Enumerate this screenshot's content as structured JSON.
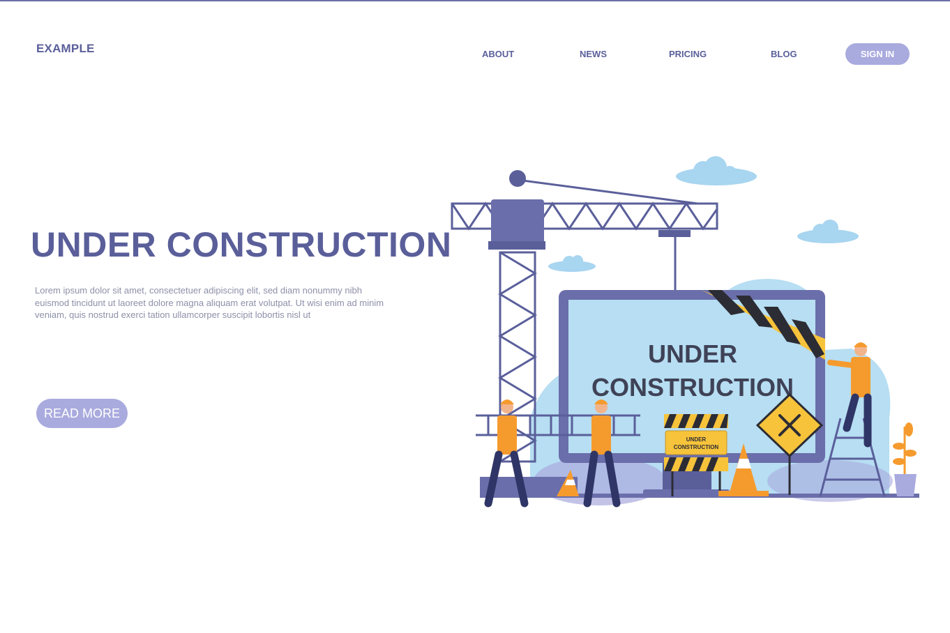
{
  "header": {
    "logo": "EXAMPLE",
    "nav": [
      "ABOUT",
      "NEWS",
      "PRICING",
      "BLOG"
    ],
    "signin": "SIGN IN"
  },
  "hero": {
    "title": "UNDER CONSTRUCTION",
    "body": "Lorem ipsum dolor sit amet, consectetuer adipiscing elit, sed diam nonummy nibh euismod tincidunt ut laoreet dolore magna aliquam erat volutpat. Ut wisi enim ad minim veniam, quis nostrud exerci tation ullamcorper suscipit lobortis nisl ut",
    "cta": "READ MORE"
  },
  "illustration": {
    "screen_title_line1": "UNDER",
    "screen_title_line2": "CONSTRUCTION",
    "barrier_sign_line1": "UNDER",
    "barrier_sign_line2": "CONSTRUCTION"
  },
  "colors": {
    "primary": "#5a5f9a",
    "button": "#a9aade",
    "screen": "#b7def2",
    "stripe_yellow": "#f6c33b",
    "stripe_dark": "#2c2c34",
    "worker_orange": "#f59b2e"
  }
}
